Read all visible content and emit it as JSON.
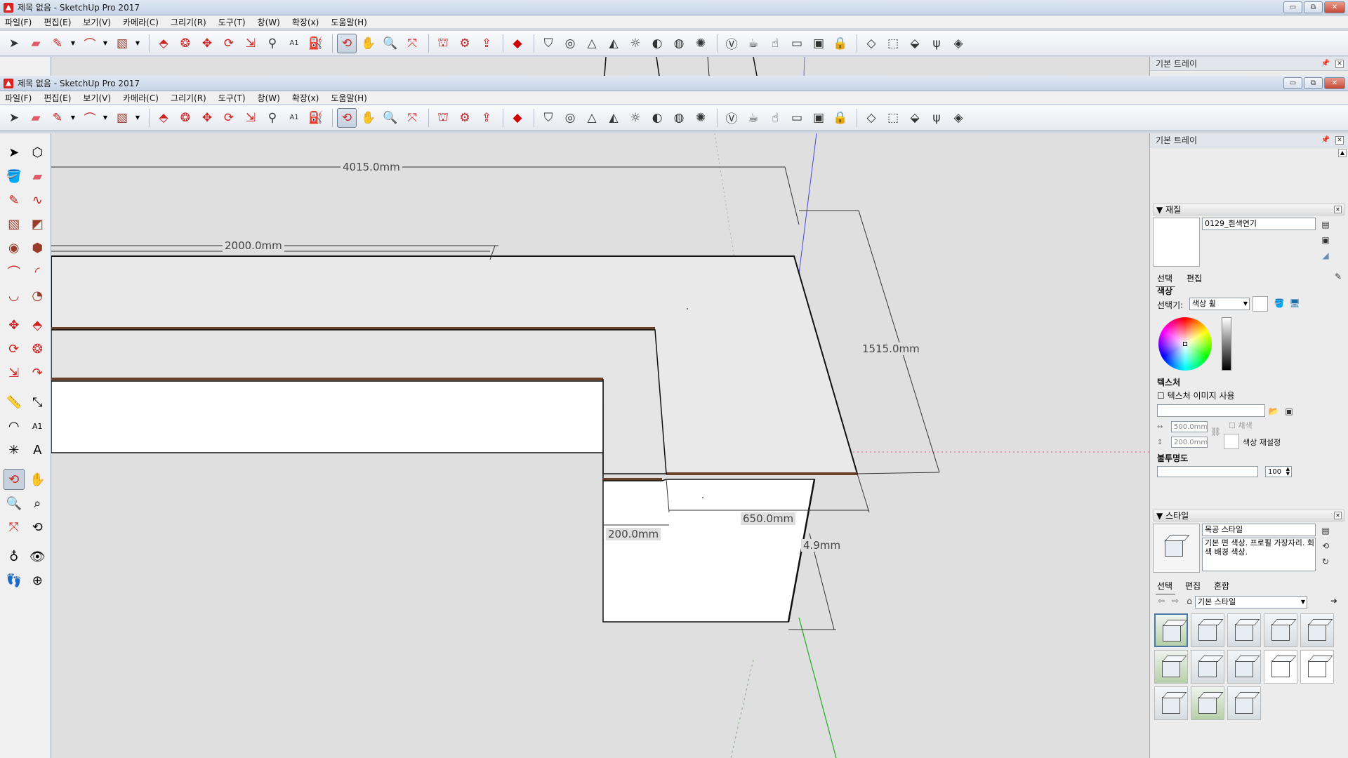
{
  "window": {
    "title": "제목 없음 - SketchUp Pro 2017",
    "bg_title": "제목 없음 - SketchUp Pro 2017",
    "min_btn": "▭",
    "restore_btn": "⧉",
    "close_btn": "✕"
  },
  "menu": [
    "파일(F)",
    "편집(E)",
    "보기(V)",
    "카메라(C)",
    "그리기(R)",
    "도구(T)",
    "창(W)",
    "확장(x)",
    "도움말(H)"
  ],
  "toolbar_icons": [
    "select-icon",
    "eraser-icon",
    "pencil-icon",
    "arc-icon",
    "rectangle-icon",
    "push-pull-icon",
    "follow-me-icon",
    "move-icon",
    "rotate-icon",
    "scale-icon",
    "tape-measure-icon",
    "text-icon",
    "paint-bucket-icon",
    "orbit-icon",
    "pan-icon",
    "zoom-icon",
    "zoom-extents-icon",
    "warehouse-icon",
    "extension-warehouse-icon",
    "share-icon",
    "ruby-icon",
    "section-icon",
    "xray-icon",
    "hidden-line-icon",
    "shaded-icon",
    "shadow-icon",
    "fog-icon",
    "display-icon",
    "monochrome-icon",
    "vray-icon",
    "teapot-icon",
    "vray-light-icon",
    "frame-icon",
    "render-icon",
    "lock-icon",
    "layer-icon",
    "component-icon",
    "sandbox-icon",
    "grass-icon",
    "material-icon"
  ],
  "viewport": {
    "dims": {
      "d1": "4015.0mm",
      "d2": "2000.0mm",
      "d3": "1515.0mm",
      "d4": "650.0mm",
      "d5": "200.0mm",
      "d6": "4.9mm"
    }
  },
  "tray": {
    "title": "기본 트레이",
    "pin": "📌",
    "materials": {
      "header": "▼ 재질",
      "name": "0129_흰색연기",
      "tab_select": "선택",
      "tab_edit": "편집",
      "color_heading": "색상",
      "picker_label": "선택기:",
      "picker_value": "색상 휠",
      "texture_heading": "텍스처",
      "use_texture_label": "텍스처 이미지 사용",
      "width_value": "500.0mm",
      "height_value": "200.0mm",
      "colorize_label": "채색",
      "reset_color_label": "색상 재설정",
      "opacity_heading": "불투명도",
      "opacity_value": "100"
    },
    "styles": {
      "header": "▼ 스타일",
      "name": "목공 스타일",
      "description": "기본 면 색상. 프로필 가장자리. 회색 배경 색상.",
      "tab_select": "선택",
      "tab_edit": "편집",
      "tab_mix": "혼합",
      "collection": "기본 스타일"
    }
  }
}
